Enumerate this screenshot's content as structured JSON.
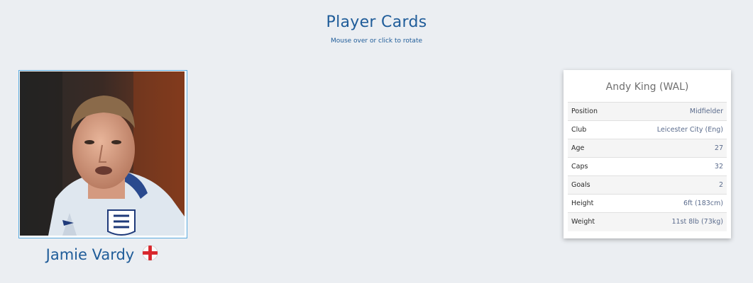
{
  "header": {
    "title": "Player Cards",
    "subtitle": "Mouse over or click to rotate"
  },
  "front_card": {
    "player_name": "Jamie Vardy",
    "flag_icon": "england-flag-icon",
    "photo_icon": "player-photo"
  },
  "back_card": {
    "title": "Andy King (WAL)",
    "stats": [
      {
        "label": "Position",
        "value": "Midfielder"
      },
      {
        "label": "Club",
        "value": "Leicester City (Eng)"
      },
      {
        "label": "Age",
        "value": "27"
      },
      {
        "label": "Caps",
        "value": "32"
      },
      {
        "label": "Goals",
        "value": "2"
      },
      {
        "label": "Height",
        "value": "6ft (183cm)"
      },
      {
        "label": "Weight",
        "value": "11st 8lb (73kg)"
      }
    ]
  },
  "colors": {
    "accent": "#1f5c99",
    "background": "#ebeef2",
    "photo_border": "#58a9de",
    "stat_value": "#5a6b8c"
  }
}
